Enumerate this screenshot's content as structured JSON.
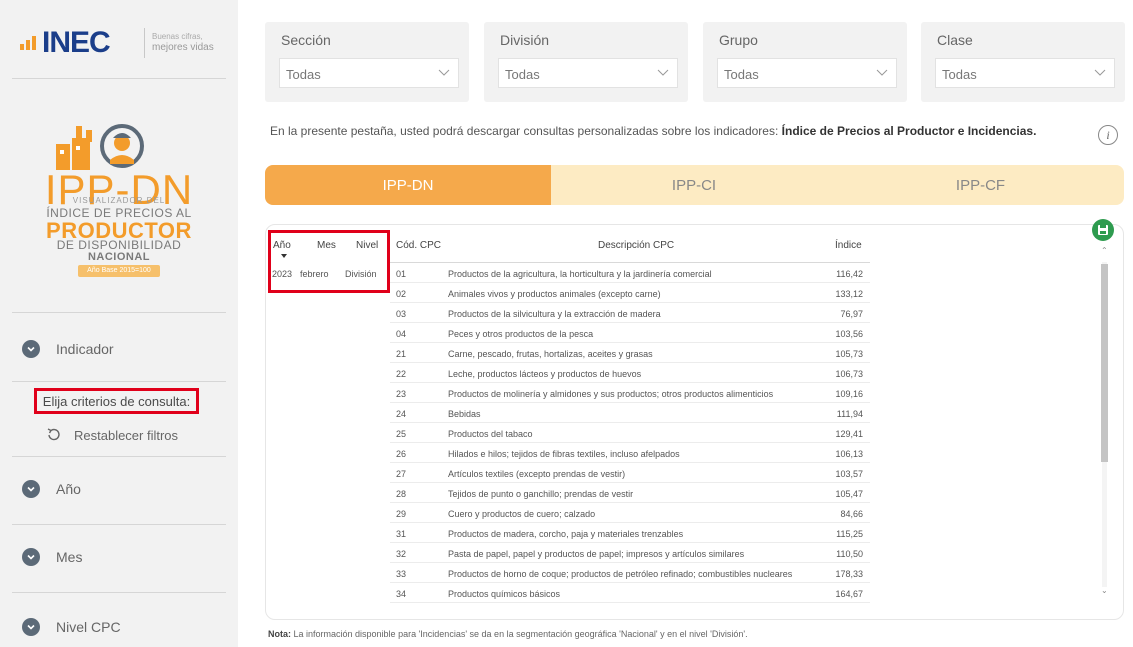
{
  "logo": {
    "brand": "INEC",
    "tagline_line1": "Buenas cifras,",
    "tagline_line2": "mejores vidas"
  },
  "visualizer": {
    "title": "IPP-DN",
    "line1": "VISUALIZADOR DEL",
    "line2": "ÍNDICE DE PRECIOS AL",
    "line3": "PRODUCTOR",
    "line4": "DE DISPONIBILIDAD",
    "line5": "NACIONAL",
    "badge": "Año Base 2015=100"
  },
  "sidebar": {
    "items": [
      {
        "label": "Indicador"
      },
      {
        "label": "Año"
      },
      {
        "label": "Mes"
      },
      {
        "label": "Nivel CPC"
      }
    ],
    "criteria_label": "Elija criterios de consulta:",
    "reset_label": "Restablecer filtros"
  },
  "filters": [
    {
      "label": "Sección",
      "value": "Todas"
    },
    {
      "label": "División",
      "value": "Todas"
    },
    {
      "label": "Grupo",
      "value": "Todas"
    },
    {
      "label": "Clase",
      "value": "Todas"
    }
  ],
  "intro": {
    "text": "En la presente pestaña, usted podrá descargar consultas personalizadas sobre los indicadores: ",
    "bold": "Índice de Precios al Productor e Incidencias."
  },
  "tabs": [
    {
      "label": "IPP-DN",
      "active": true
    },
    {
      "label": "IPP-CI",
      "active": false
    },
    {
      "label": "IPP-CF",
      "active": false
    }
  ],
  "table": {
    "left_headers": {
      "year": "Año",
      "month": "Mes",
      "level": "Nivel"
    },
    "left_values": {
      "year": "2023",
      "month": "febrero",
      "level": "División"
    },
    "headers": {
      "code": "Cód. CPC",
      "desc": "Descripción CPC",
      "index": "Índice"
    },
    "rows": [
      {
        "code": "01",
        "desc": "Productos de la agricultura, la horticultura y la jardinería comercial",
        "index": "116,42"
      },
      {
        "code": "02",
        "desc": "Animales vivos y productos animales (excepto carne)",
        "index": "133,12"
      },
      {
        "code": "03",
        "desc": "Productos de la silvicultura y la extracción de madera",
        "index": "76,97"
      },
      {
        "code": "04",
        "desc": "Peces y otros productos de la pesca",
        "index": "103,56"
      },
      {
        "code": "21",
        "desc": "Carne, pescado, frutas, hortalizas, aceites y grasas",
        "index": "105,73"
      },
      {
        "code": "22",
        "desc": "Leche, productos lácteos y productos de huevos",
        "index": "106,73"
      },
      {
        "code": "23",
        "desc": "Productos de molinería y almidones y sus productos; otros productos alimenticios",
        "index": "109,16"
      },
      {
        "code": "24",
        "desc": "Bebidas",
        "index": "111,94"
      },
      {
        "code": "25",
        "desc": "Productos del tabaco",
        "index": "129,41"
      },
      {
        "code": "26",
        "desc": "Hilados e hilos; tejidos de fibras textiles, incluso afelpados",
        "index": "106,13"
      },
      {
        "code": "27",
        "desc": "Artículos textiles (excepto prendas de vestir)",
        "index": "103,57"
      },
      {
        "code": "28",
        "desc": "Tejidos de punto o ganchillo; prendas de vestir",
        "index": "105,47"
      },
      {
        "code": "29",
        "desc": "Cuero y productos de cuero; calzado",
        "index": "84,66"
      },
      {
        "code": "31",
        "desc": "Productos de madera, corcho, paja y materiales trenzables",
        "index": "115,25"
      },
      {
        "code": "32",
        "desc": "Pasta de papel, papel y productos de papel; impresos y artículos similares",
        "index": "110,50"
      },
      {
        "code": "33",
        "desc": "Productos de horno de coque; productos de petróleo refinado; combustibles nucleares",
        "index": "178,33"
      },
      {
        "code": "34",
        "desc": "Productos químicos básicos",
        "index": "164,67"
      }
    ]
  },
  "note": {
    "bold": "Nota:",
    "text": " La información disponible para 'Incidencias' se da en la segmentación geográfica 'Nacional' y en el nivel 'División'."
  },
  "colors": {
    "accent": "#f5a94b",
    "brand_blue": "#1b3e8a",
    "highlight_red": "#e0001a",
    "tab_inactive": "#fdebc3"
  }
}
